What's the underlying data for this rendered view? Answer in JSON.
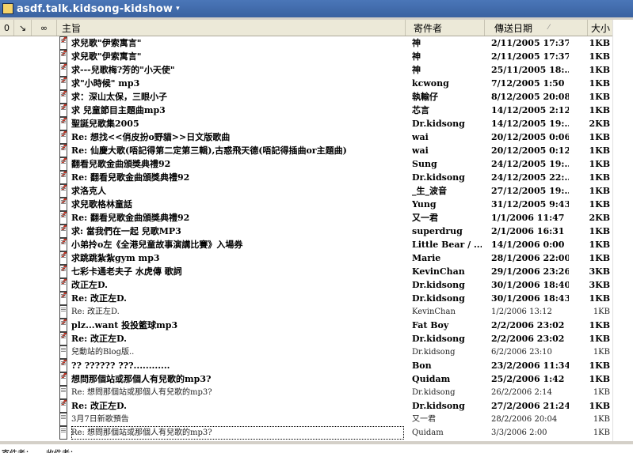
{
  "window": {
    "title": "asdf.talk.kidsong-kidshow",
    "title_caret": "▾"
  },
  "header": {
    "icons": [
      {
        "name": "attachment-icon",
        "glyph": "0"
      },
      {
        "name": "flag-icon",
        "glyph": "↘"
      },
      {
        "name": "glasses-icon",
        "glyph": "∞"
      }
    ],
    "subject_label": "主旨",
    "from_label": "寄件者",
    "date_label": "傳送日期",
    "sort_glyph": "⁄",
    "size_label": "大小"
  },
  "messages": [
    {
      "subject": "求兒歌\"伊索寓言\"",
      "from": "神",
      "date": "2/11/2005 17:37",
      "size": "1KB",
      "read": false
    },
    {
      "subject": "求兒歌\"伊索寓言\"",
      "from": "神",
      "date": "2/11/2005 17:37",
      "size": "1KB",
      "read": false
    },
    {
      "subject": "求---兒歌梅?芳的\"小天使\"",
      "from": "神",
      "date": "25/11/2005 18:...",
      "size": "1KB",
      "read": false
    },
    {
      "subject": "求\"小時候\" mp3",
      "from": "kcwong",
      "date": "7/12/2005 1:50",
      "size": "1KB",
      "read": false
    },
    {
      "subject": "求：深山太保，三眼小子",
      "from": "執輸仔",
      "date": "8/12/2005 20:08",
      "size": "1KB",
      "read": false
    },
    {
      "subject": "求 兒童節目主題曲mp3",
      "from": "芯言",
      "date": "14/12/2005 2:12",
      "size": "1KB",
      "read": false
    },
    {
      "subject": "聖誕兒歌集2005",
      "from": "Dr.kidsong",
      "date": "14/12/2005 19:...",
      "size": "2KB",
      "read": false
    },
    {
      "subject": "Re: 想找<<俏皮扮o野貓>>日文版歌曲",
      "from": "wai",
      "date": "20/12/2005 0:06",
      "size": "1KB",
      "read": false
    },
    {
      "subject": "Re: 仙慶大歌(唔記得第二定第三輯),古惑飛天德(唔記得插曲or主題曲)",
      "from": "wai",
      "date": "20/12/2005 0:12",
      "size": "1KB",
      "read": false
    },
    {
      "subject": "翻看兒歌金曲頒獎典禮92",
      "from": "Sung",
      "date": "24/12/2005 19:...",
      "size": "1KB",
      "read": false
    },
    {
      "subject": "Re: 翻看兒歌金曲頒獎典禮92",
      "from": "Dr.kidsong",
      "date": "24/12/2005 22:...",
      "size": "1KB",
      "read": false
    },
    {
      "subject": "求洛克人",
      "from": "_生_波音",
      "date": "27/12/2005 19:...",
      "size": "1KB",
      "read": false
    },
    {
      "subject": "求兒歌格林童話",
      "from": "Yung",
      "date": "31/12/2005 9:43",
      "size": "1KB",
      "read": false
    },
    {
      "subject": "Re: 翻看兒歌金曲頒獎典禮92",
      "from": "又一君",
      "date": "1/1/2006 11:47",
      "size": "2KB",
      "read": false
    },
    {
      "subject": "求: 當我們在一起 兒歌MP3",
      "from": "superdrug",
      "date": "2/1/2006 16:31",
      "size": "1KB",
      "read": false
    },
    {
      "subject": "小弟拎o左《全港兒童故事演講比賽》入場券",
      "from": "Little Bear / ...",
      "date": "14/1/2006 0:00",
      "size": "1KB",
      "read": false
    },
    {
      "subject": "求跳跳紮紮gym mp3",
      "from": "Marie",
      "date": "28/1/2006 22:00",
      "size": "1KB",
      "read": false
    },
    {
      "subject": "七彩卡通老夫子 水虎傳 歌詞",
      "from": "KevinChan",
      "date": "29/1/2006 23:26",
      "size": "3KB",
      "read": false
    },
    {
      "subject": "改正左D.",
      "from": "Dr.kidsong",
      "date": "30/1/2006 18:40",
      "size": "3KB",
      "read": false
    },
    {
      "subject": "Re: 改正左D.",
      "from": "Dr.kidsong",
      "date": "30/1/2006 18:43",
      "size": "1KB",
      "read": false
    },
    {
      "subject": "Re: 改正左D.",
      "from": "KevinChan",
      "date": "1/2/2006 13:12",
      "size": "1KB",
      "read": true
    },
    {
      "subject": "plz...want 投投籃球mp3",
      "from": "Fat Boy",
      "date": "2/2/2006 23:02",
      "size": "1KB",
      "read": false
    },
    {
      "subject": "Re: 改正左D.",
      "from": "Dr.kidsong",
      "date": "2/2/2006 23:02",
      "size": "1KB",
      "read": false
    },
    {
      "subject": "兒動站的Blog版..",
      "from": "Dr.kidsong",
      "date": "6/2/2006 23:10",
      "size": "1KB",
      "read": true
    },
    {
      "subject": "?? ?????? ???............",
      "from": "Bon",
      "date": "23/2/2006 11:34",
      "size": "1KB",
      "read": false
    },
    {
      "subject": "想問那個站或那個人有兒歌的mp3?",
      "from": "Quidam",
      "date": "25/2/2006 1:42",
      "size": "1KB",
      "read": false
    },
    {
      "subject": "Re: 想問那個站或那個人有兒歌的mp3?",
      "from": "Dr.kidsong",
      "date": "26/2/2006 2:14",
      "size": "1KB",
      "read": true
    },
    {
      "subject": "Re: 改正左D.",
      "from": "Dr.kidsong",
      "date": "27/2/2006 21:24",
      "size": "1KB",
      "read": false
    },
    {
      "subject": "3月7日新歌預告",
      "from": "又一君",
      "date": "28/2/2006 20:04",
      "size": "1KB",
      "read": true
    },
    {
      "subject": "Re: 想問那個站或那個人有兒歌的mp3?",
      "from": "Quidam",
      "date": "3/3/2006 2:00",
      "size": "1KB",
      "read": true,
      "selected": true
    }
  ],
  "footer": {
    "left_text": "寄件者：",
    "right_text": "收件者："
  }
}
